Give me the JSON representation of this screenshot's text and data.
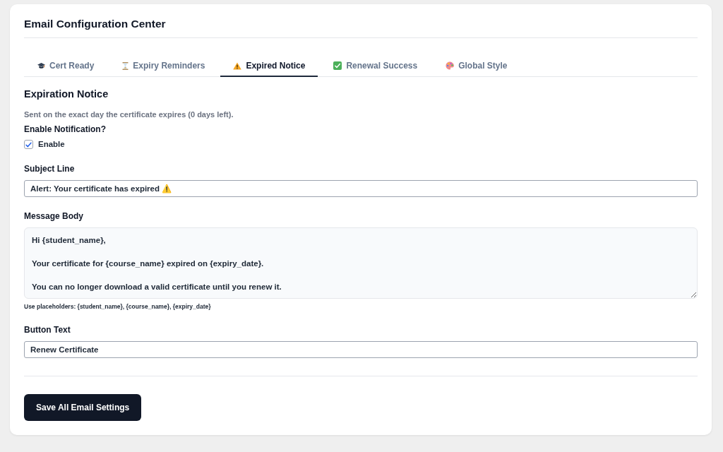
{
  "card": {
    "title": "Email Configuration Center"
  },
  "tabs": [
    {
      "label": "Cert Ready",
      "selected": false
    },
    {
      "label": "Expiry Reminders",
      "selected": false
    },
    {
      "label": "Expired Notice",
      "selected": true
    },
    {
      "label": "Renewal Success",
      "selected": false
    },
    {
      "label": "Global Style",
      "selected": false
    }
  ],
  "section": {
    "heading": "Expiration Notice",
    "description": "Sent on the exact day the certificate expires (0 days left).",
    "notification": {
      "label": "Enable Notification?",
      "option": "Enable",
      "checked": true
    },
    "fields": [
      {
        "kind": "input",
        "label": "Subject Line",
        "value": "Alert: Your certificate has expired ⚠️"
      },
      {
        "kind": "textarea",
        "label": "Message Body",
        "value": "Hi {student_name},\n\nYour certificate for {course_name} expired on {expiry_date}.\n\nYou can no longer download a valid certificate until you renew it.",
        "hint": "Use placeholders: {student_name}, {course_name}, {expiry_date}"
      },
      {
        "kind": "input",
        "label": "Button Text",
        "value": "Renew Certificate"
      }
    ]
  },
  "save_button": {
    "label": "Save All Email Settings"
  }
}
